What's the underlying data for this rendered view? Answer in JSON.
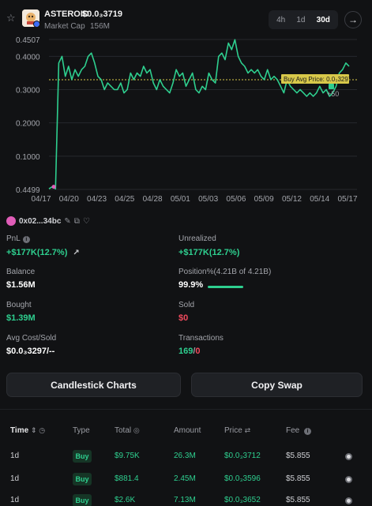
{
  "header": {
    "token_name": "ASTEROID",
    "token_price": "$0.0₃3719",
    "market_cap_label": "Market Cap",
    "market_cap_value": "156M",
    "timeframes": [
      "4h",
      "1d",
      "30d"
    ],
    "active_timeframe": "30d",
    "star_icon": "star-outline-icon",
    "next_icon": "arrow-right-icon"
  },
  "chart_data": {
    "type": "line",
    "ytick_labels": [
      "0.4507",
      "0.4000",
      "0.3000",
      "0.2000",
      "0.1000",
      "0.4499"
    ],
    "xtick_labels": [
      "04/17",
      "04/20",
      "04/23",
      "04/25",
      "04/28",
      "05/01",
      "05/03",
      "05/06",
      "05/09",
      "05/12",
      "05/14",
      "05/17"
    ],
    "series": [
      {
        "color": "#2ecf8f",
        "y": [
          0.002,
          0.008,
          0.002,
          0.38,
          0.4,
          0.34,
          0.37,
          0.33,
          0.36,
          0.34,
          0.36,
          0.37,
          0.4,
          0.41,
          0.38,
          0.34,
          0.33,
          0.3,
          0.32,
          0.31,
          0.3,
          0.3,
          0.32,
          0.29,
          0.3,
          0.35,
          0.33,
          0.35,
          0.34,
          0.37,
          0.35,
          0.36,
          0.32,
          0.3,
          0.33,
          0.31,
          0.3,
          0.29,
          0.32,
          0.36,
          0.34,
          0.35,
          0.31,
          0.33,
          0.35,
          0.3,
          0.29,
          0.31,
          0.3,
          0.35,
          0.33,
          0.32,
          0.4,
          0.41,
          0.39,
          0.44,
          0.42,
          0.45,
          0.4,
          0.38,
          0.37,
          0.35,
          0.36,
          0.35,
          0.36,
          0.34,
          0.33,
          0.36,
          0.33,
          0.34,
          0.33,
          0.31,
          0.29,
          0.33,
          0.31,
          0.3,
          0.29,
          0.3,
          0.29,
          0.28,
          0.29,
          0.28,
          0.29,
          0.31,
          0.29,
          0.3,
          0.28,
          0.29,
          0.31,
          0.35,
          0.36,
          0.38,
          0.37
        ]
      }
    ],
    "buy_avg_line": 0.3297,
    "buy_avg_label": "Buy Avg Price: 0.0₃3297",
    "marker_label": "+50",
    "line_color": "#2ecf8f",
    "avg_line_color": "#d8c84a",
    "grid": true
  },
  "wallet": {
    "address": "0x02...34bc",
    "icons": [
      "pencil-icon",
      "copy-icon",
      "heart-icon"
    ]
  },
  "stats": {
    "pnl_label": "PnL",
    "pnl_value": "+$177K(12.7%)",
    "unrealized_label": "Unrealized",
    "unrealized_value": "+$177K(12.7%)",
    "balance_label": "Balance",
    "balance_value": "$1.56M",
    "position_label": "Position%(4.21B of 4.21B)",
    "position_value": "99.9%",
    "position_fraction": 0.999,
    "bought_label": "Bought",
    "bought_value": "$1.39M",
    "sold_label": "Sold",
    "sold_value": "$0",
    "avg_cost_label": "Avg Cost/Sold",
    "avg_cost_value": "$0.0₃3297/--",
    "transactions_label": "Transactions",
    "transactions_buys": "169",
    "transactions_sep": "/",
    "transactions_sells": "0"
  },
  "actions": {
    "candlestick_label": "Candlestick Charts",
    "copy_swap_label": "Copy Swap"
  },
  "table": {
    "headers": {
      "time": "Time",
      "type": "Type",
      "total": "Total",
      "amount": "Amount",
      "price": "Price",
      "fee": "Fee"
    },
    "rows": [
      {
        "time": "1d",
        "type": "Buy",
        "total": "$9.75K",
        "amount": "26.3M",
        "price": "$0.0₃3712",
        "fee": "$5.855"
      },
      {
        "time": "1d",
        "type": "Buy",
        "total": "$881.4",
        "amount": "2.45M",
        "price": "$0.0₃3596",
        "fee": "$5.855"
      },
      {
        "time": "1d",
        "type": "Buy",
        "total": "$2.6K",
        "amount": "7.13M",
        "price": "$0.0₃3652",
        "fee": "$5.855"
      }
    ]
  }
}
